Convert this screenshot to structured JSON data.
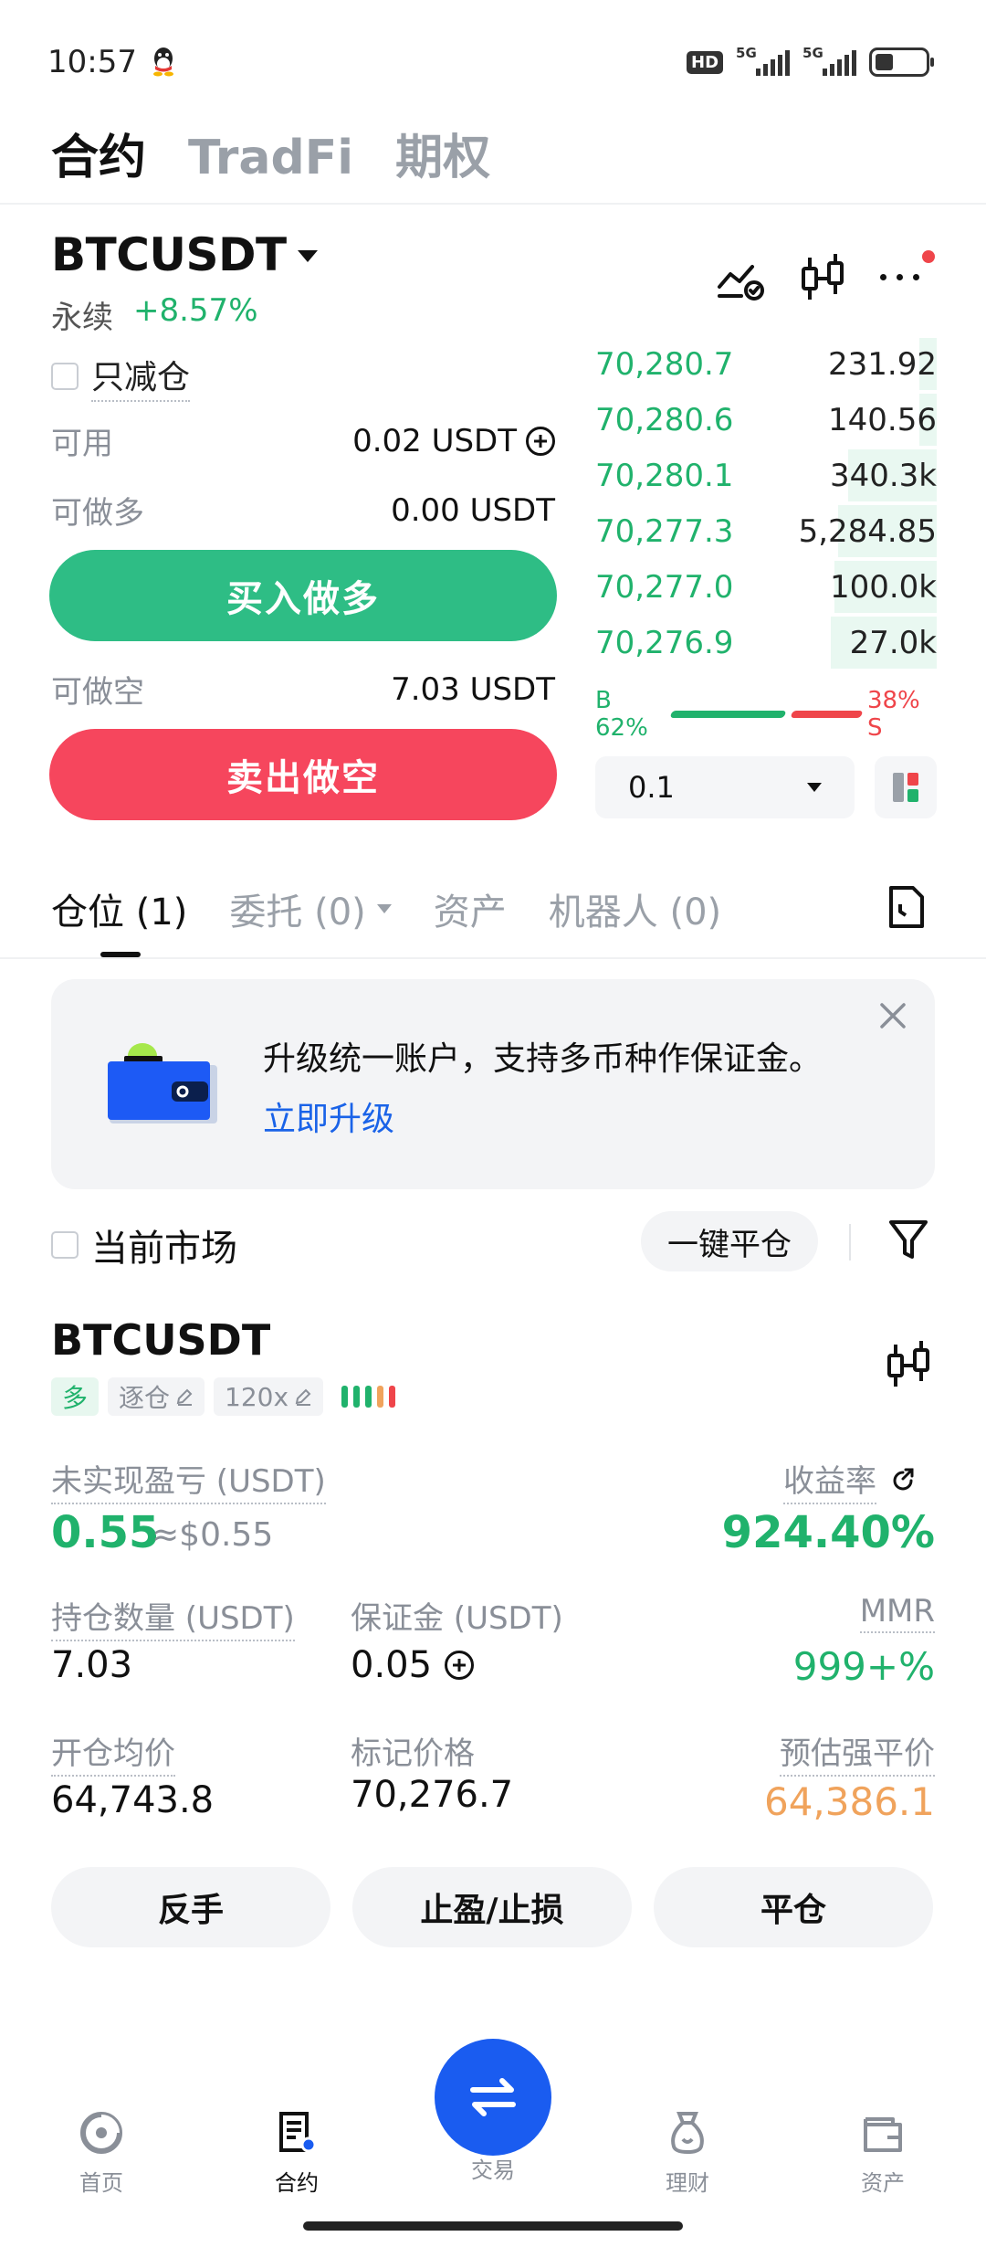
{
  "status_bar": {
    "time": "10:57",
    "network_badge": "HD",
    "signal_1": "5G",
    "signal_2": "5G",
    "battery_level": 0.35
  },
  "top_tabs": [
    {
      "label": "合约",
      "active": true
    },
    {
      "label": "TradFi",
      "active": false
    },
    {
      "label": "期权",
      "active": false
    }
  ],
  "header": {
    "symbol": "BTCUSDT",
    "type": "永续",
    "change": "+8.57%"
  },
  "form": {
    "reduce_only": "只减仓",
    "available_label": "可用",
    "available_value": "0.02 USDT",
    "can_long_label": "可做多",
    "can_long_value": "0.00 USDT",
    "buy_button": "买入做多",
    "can_short_label": "可做空",
    "can_short_value": "7.03 USDT",
    "sell_button": "卖出做空"
  },
  "orderbook": {
    "rows": [
      {
        "price": "70,280.7",
        "qty": "231.92",
        "depth": 0.05
      },
      {
        "price": "70,280.6",
        "qty": "140.56",
        "depth": 0.05
      },
      {
        "price": "70,280.1",
        "qty": "340.3k",
        "depth": 0.26
      },
      {
        "price": "70,277.3",
        "qty": "5,284.85",
        "depth": 0.29
      },
      {
        "price": "70,277.0",
        "qty": "100.0k",
        "depth": 0.3
      },
      {
        "price": "70,276.9",
        "qty": "27.0k",
        "depth": 0.31
      }
    ],
    "buy_ratio": "B 62%",
    "sell_ratio": "38% S",
    "buy_fraction": 0.62,
    "precision": "0.1"
  },
  "position_tabs": [
    {
      "label": "仓位 (1)",
      "active": true,
      "dropdown": false
    },
    {
      "label": "委托 (0)",
      "active": false,
      "dropdown": true
    },
    {
      "label": "资产",
      "active": false,
      "dropdown": false
    },
    {
      "label": "机器人 (0)",
      "active": false,
      "dropdown": false
    }
  ],
  "banner": {
    "text": "升级统一账户，支持多币种作保证金。",
    "link": "立即升级"
  },
  "filter": {
    "current_market": "当前市场",
    "close_all": "一键平仓"
  },
  "position": {
    "symbol": "BTCUSDT",
    "tags": {
      "side": "多",
      "margin_mode": "逐仓",
      "leverage": "120x"
    },
    "unrealized_label": "未实现盈亏 (USDT)",
    "unrealized_value": "0.55",
    "unrealized_usd": "≈$0.55",
    "roi_label": "收益率",
    "roi_value": "924.40%",
    "qty_label": "持仓数量 (USDT)",
    "qty_value": "7.03",
    "margin_label": "保证金 (USDT)",
    "margin_value": "0.05",
    "mmr_label": "MMR",
    "mmr_value": "999+%",
    "entry_label": "开仓均价",
    "entry_value": "64,743.8",
    "mark_label": "标记价格",
    "mark_value": "70,276.7",
    "liq_label": "预估强平价",
    "liq_value": "64,386.1",
    "actions": [
      "反手",
      "止盈/止损",
      "平仓"
    ]
  },
  "bottom_nav": [
    {
      "label": "首页",
      "icon": "home-icon"
    },
    {
      "label": "合约",
      "icon": "futures-icon",
      "active": true
    },
    {
      "label": "交易",
      "icon": "swap-icon"
    },
    {
      "label": "理财",
      "icon": "earn-icon"
    },
    {
      "label": "资产",
      "icon": "wallet-icon"
    }
  ],
  "colors": {
    "green": "#20b26c",
    "red": "#ef454a",
    "blue": "#1a5cf0",
    "orange": "#f0a35c"
  }
}
